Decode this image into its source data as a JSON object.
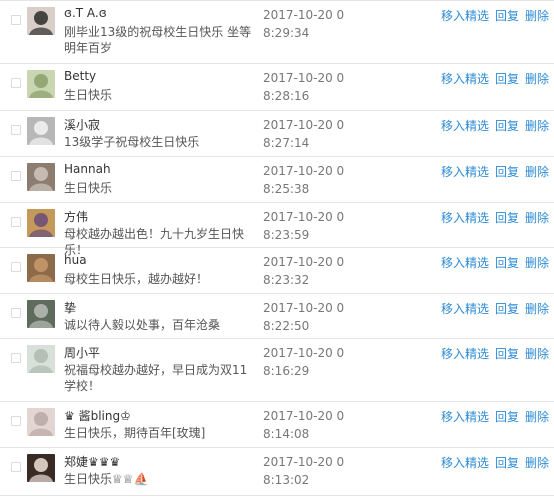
{
  "comments": [
    {
      "name": "ɞ.T A.ɞ",
      "message": "刚毕业13级的祝母校生日快乐 坐等明年百岁",
      "time": "2017-10-20 08:29:34",
      "avatar_colors": [
        "#2b2b2b",
        "#d9cfc8"
      ]
    },
    {
      "name": "Betty",
      "message": "生日快乐",
      "time": "2017-10-20 08:28:16",
      "avatar_colors": [
        "#8aa06a",
        "#c9d6b1"
      ]
    },
    {
      "name": "溪小寂",
      "message": "13级学子祝母校生日快乐",
      "time": "2017-10-20 08:27:14",
      "avatar_colors": [
        "#f4f4f4",
        "#b7b7b7"
      ]
    },
    {
      "name": "Hannah",
      "message": "生日快乐",
      "time": "2017-10-20 08:25:38",
      "avatar_colors": [
        "#cfc6bd",
        "#8c7d70"
      ]
    },
    {
      "name": "方伟",
      "message": "母校越办越出色！九十九岁生日快乐！",
      "time": "2017-10-20 08:23:59",
      "avatar_colors": [
        "#6b4a7a",
        "#c49a5a"
      ]
    },
    {
      "name": "hua",
      "message": "母校生日快乐，越办越好！",
      "time": "2017-10-20 08:23:32",
      "avatar_colors": [
        "#c89a6a",
        "#8c6a4a"
      ]
    },
    {
      "name": "挚",
      "message": "诚以待人毅以处事，百年沧桑",
      "time": "2017-10-20 08:22:50",
      "avatar_colors": [
        "#b8bdb6",
        "#5f6b5c"
      ]
    },
    {
      "name": "周小平",
      "message": "祝福母校越办越好，早日成为双11学校！",
      "time": "2017-10-20 08:16:29",
      "avatar_colors": [
        "#aeb9ae",
        "#d8e0da"
      ]
    },
    {
      "name": "♛ 酱bling♔",
      "message": "生日快乐，期待百年[玫瑰]",
      "time": "2017-10-20 08:14:08",
      "avatar_colors": [
        "#b9a7a3",
        "#e3d6d2"
      ]
    },
    {
      "name": "郑婕♛♛♛",
      "message": "生日快乐♕♕⛵",
      "time": "2017-10-20 08:13:02",
      "avatar_colors": [
        "#f0e0d8",
        "#3a2a26"
      ]
    }
  ],
  "actions": {
    "feature": "移入精选",
    "reply": "回复",
    "delete": "删除"
  },
  "colors": {
    "link": "#2e8bd6",
    "divider": "#e5e5e5",
    "time": "#777777"
  }
}
